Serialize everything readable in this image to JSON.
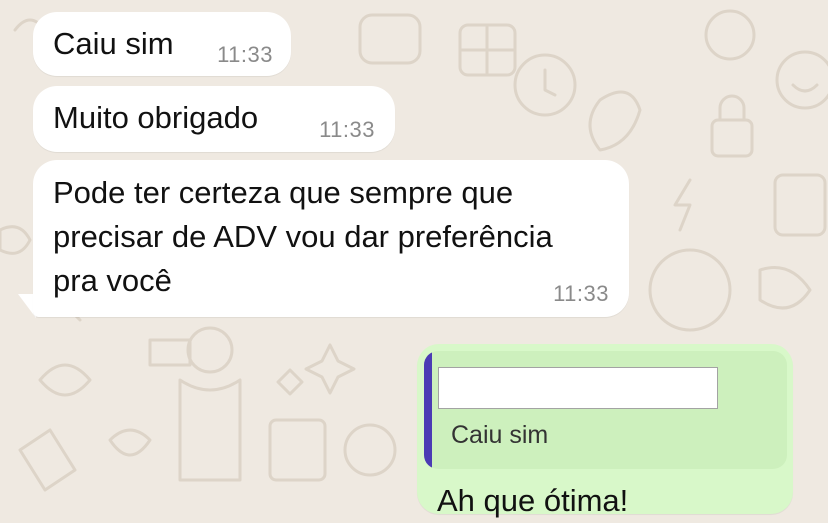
{
  "chat": {
    "messages": [
      {
        "direction": "incoming",
        "text": "Caiu sim",
        "time": "11:33"
      },
      {
        "direction": "incoming",
        "text": "Muito obrigado",
        "time": "11:33"
      },
      {
        "direction": "incoming",
        "text": "Pode ter certeza que sempre que\nprecisar de ADV vou dar preferência\npra você",
        "time": "11:33"
      },
      {
        "direction": "outgoing",
        "quote": {
          "author": "",
          "text": "Caiu sim"
        },
        "text": "Ah que ótima!"
      }
    ]
  },
  "colors": {
    "wallpaper": "#efe9e1",
    "incoming_bubble": "#ffffff",
    "outgoing_bubble": "#d8f8c9",
    "quote_bar": "#4b3bb4",
    "timestamp": "#8a8a8a"
  }
}
